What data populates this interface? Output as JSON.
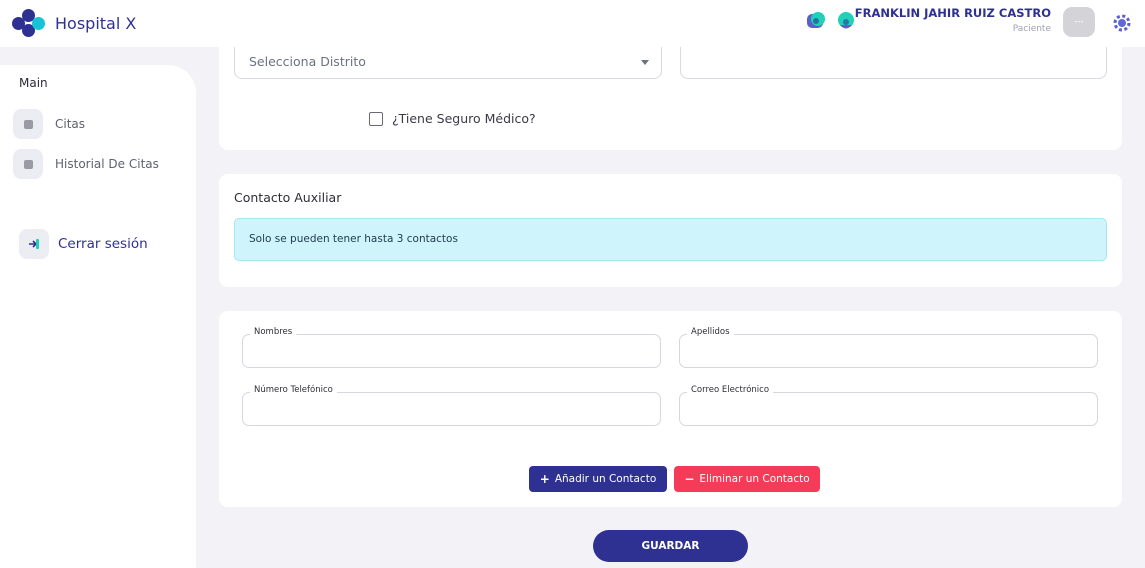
{
  "header": {
    "app_title": "Hospital X",
    "user_name": "FRANKLIN JAHIR RUIZ CASTRO",
    "user_role": "Paciente",
    "avatar_text": "---"
  },
  "sidebar": {
    "section_title": "Main",
    "items": [
      {
        "label": "Citas",
        "icon": "calendar-icon"
      },
      {
        "label": "Historial De Citas",
        "icon": "history-icon"
      }
    ],
    "logout_label": "Cerrar sesión"
  },
  "form_top": {
    "district_placeholder": "Selecciona Distrito",
    "insurance_checkbox_label": "¿Tiene Seguro Médico?",
    "insurance_checked": false
  },
  "aux_contact": {
    "title": "Contacto Auxiliar",
    "alert_text": "Solo se pueden tener hasta 3 contactos"
  },
  "contact_form": {
    "first_name_label": "Nombres",
    "last_name_label": "Apellidos",
    "phone_label": "Número Telefónico",
    "email_label": "Correo Electrónico",
    "add_button": "Añadir un Contacto",
    "remove_button": "Eliminar un Contacto"
  },
  "save_button": "GUARDAR",
  "colors": {
    "primary": "#2e3192",
    "danger": "#f53b57",
    "info_bg": "#cff4fb",
    "logo_blue": "#2e3192",
    "logo_cyan": "#19c3d6",
    "logo_teal": "#1fd1b8"
  }
}
